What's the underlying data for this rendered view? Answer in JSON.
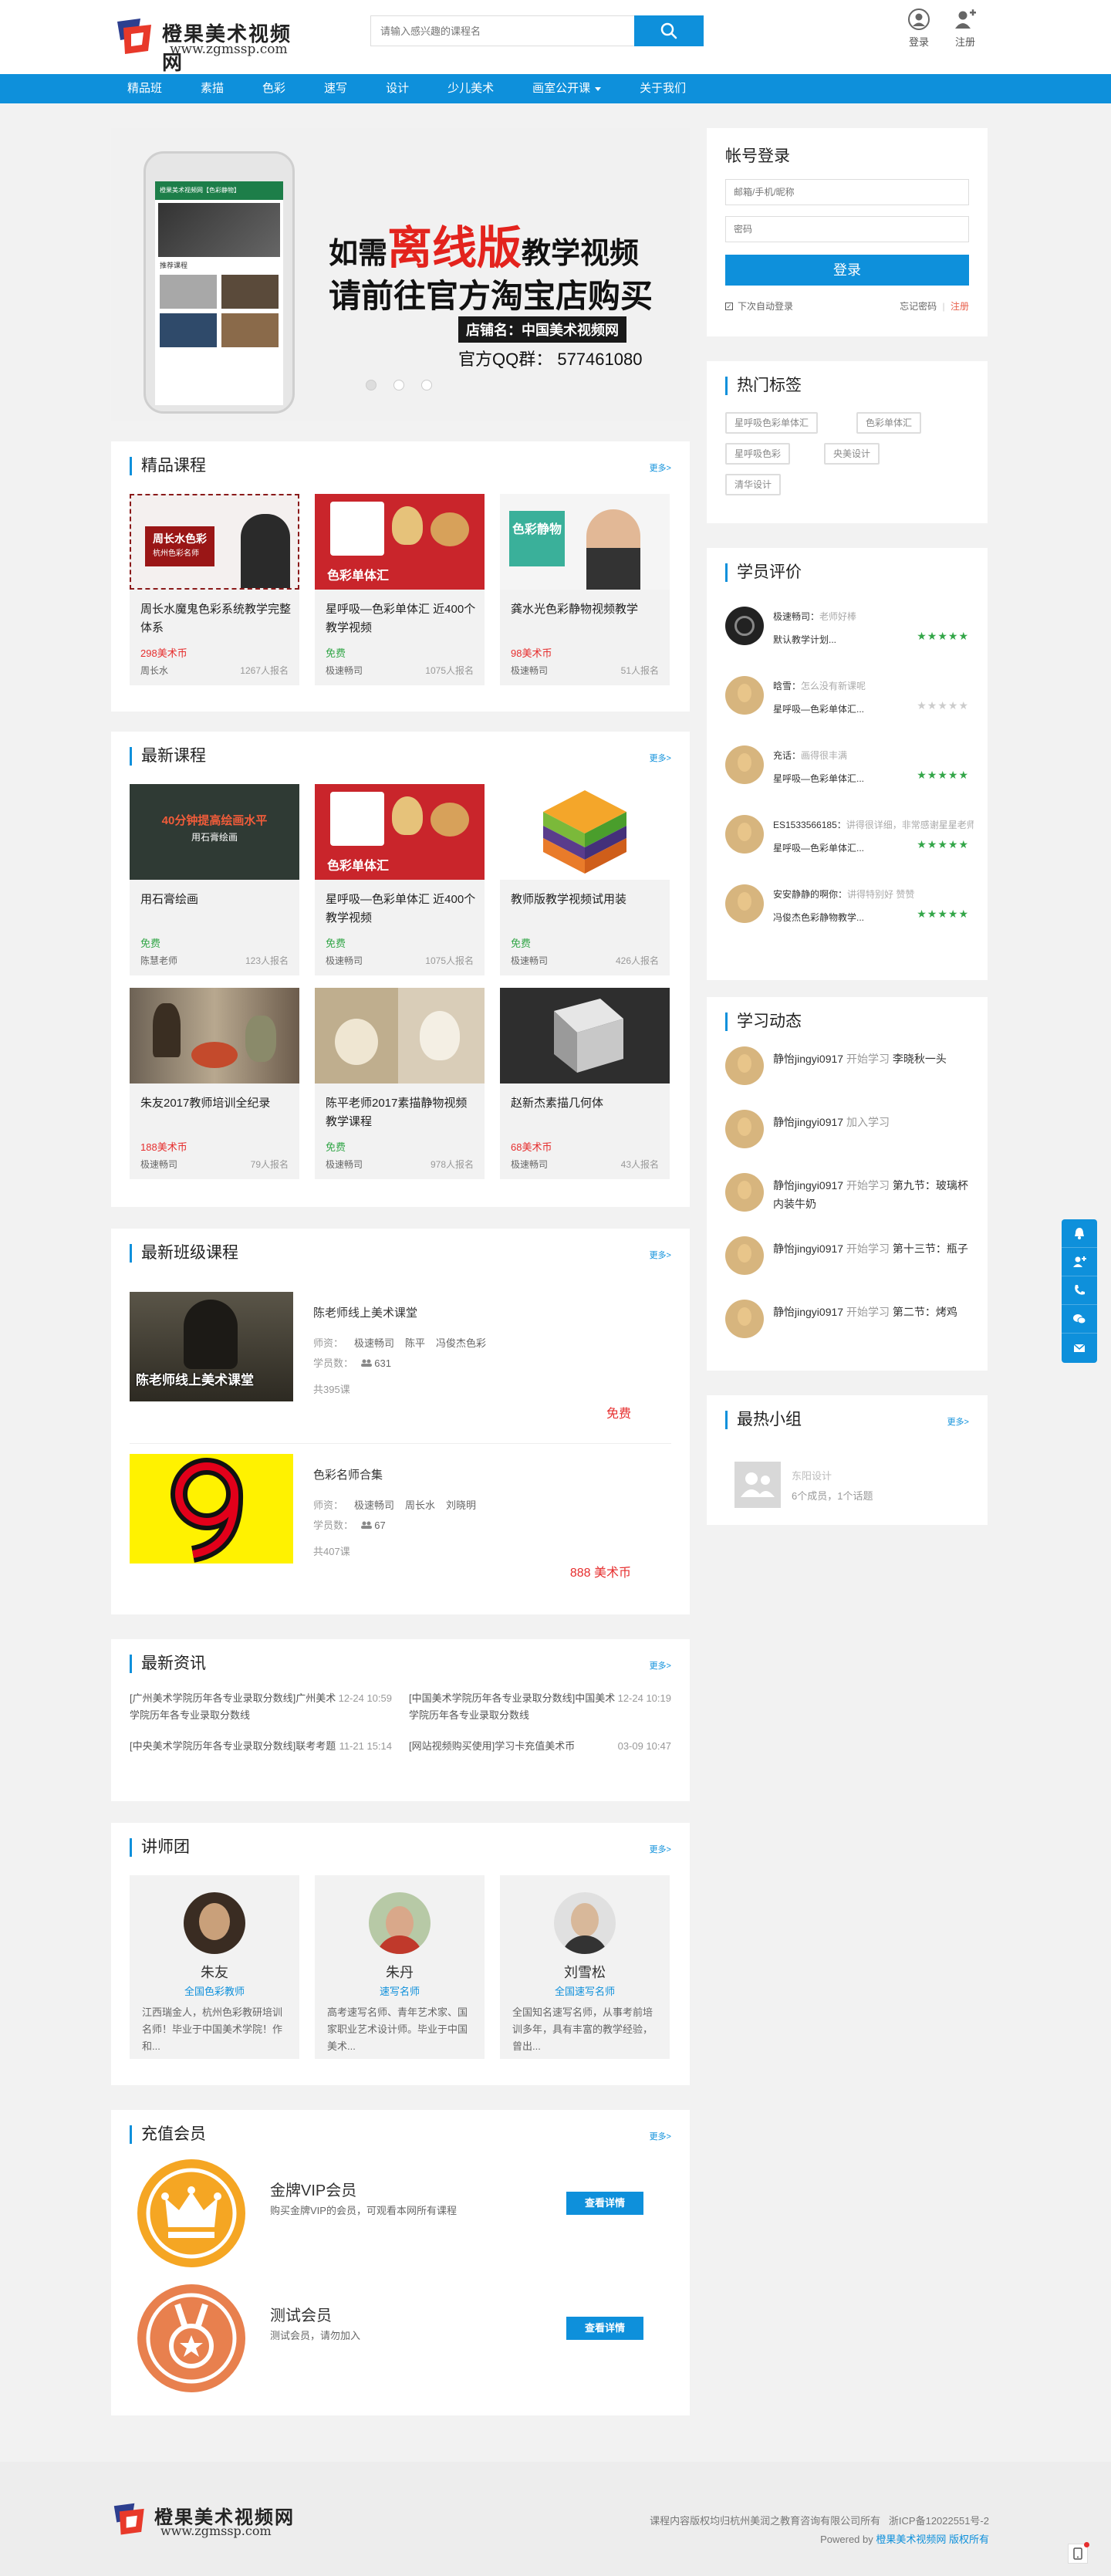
{
  "header": {
    "logo_title": "橙果美术视频网",
    "logo_url": "www.zgmssp.com",
    "search_placeholder": "请输入感兴趣的课程名",
    "login_label": "登录",
    "register_label": "注册"
  },
  "nav": [
    "精品班",
    "素描",
    "色彩",
    "速写",
    "设计",
    "少儿美术",
    "画室公开课",
    "关于我们"
  ],
  "banner": {
    "line1_pre": "如需",
    "line1_em": "离线版",
    "line1_post": "教学视频",
    "line2": "请前往官方淘宝店购买",
    "shop": "店铺名：中国美术视频网",
    "qq": "官方QQ群： 577461080",
    "phone_title": "橙果美术视频网【色彩静物】",
    "phone_sub": "推荐课程"
  },
  "featured": {
    "title": "精品课程",
    "more": "更多>",
    "items": [
      {
        "title": "周长水魔鬼色彩系统教学完整体系",
        "price": "298美术币",
        "author": "周长水",
        "students": "1267人报名",
        "img_text": "周长水色彩",
        "img_sub": "杭州色彩名师"
      },
      {
        "title": "星呼吸—色彩单体汇 近400个教学视频",
        "price": "免费",
        "author": "极速畅司",
        "students": "1075人报名",
        "img_text": "色彩单体汇"
      },
      {
        "title": "龚水光色彩静物视频教学",
        "price": "98美术币",
        "author": "极速畅司",
        "students": "51人报名",
        "img_text": "色彩静物"
      }
    ]
  },
  "latest": {
    "title": "最新课程",
    "more": "更多>",
    "items": [
      {
        "title": "用石膏绘画",
        "price": "免费",
        "author": "陈慧老师",
        "students": "123人报名",
        "img_text": "40分钟提高绘画水平",
        "img_sub": "用石膏绘画"
      },
      {
        "title": "星呼吸—色彩单体汇 近400个教学视频",
        "price": "免费",
        "author": "极速畅司",
        "students": "1075人报名",
        "img_text": "色彩单体汇"
      },
      {
        "title": "教师版教学视频试用装",
        "price": "免费",
        "author": "极速畅司",
        "students": "426人报名"
      },
      {
        "title": "朱友2017教师培训全纪录",
        "price": "188美术币",
        "author": "极速畅司",
        "students": "79人报名"
      },
      {
        "title": "陈平老师2017素描静物视频教学课程",
        "price": "免费",
        "author": "极速畅司",
        "students": "978人报名"
      },
      {
        "title": "赵新杰素描几何体",
        "price": "68美术币",
        "author": "极速畅司",
        "students": "43人报名"
      }
    ]
  },
  "classes": {
    "title": "最新班级课程",
    "more": "更多>",
    "items": [
      {
        "title": "陈老师线上美术课堂",
        "teachers_label": "师资：",
        "teachers": [
          "极速畅司",
          "陈平",
          "冯俊杰色彩"
        ],
        "students_label": "学员数：",
        "students": "631",
        "lessons": "共395课",
        "price": "免费",
        "img_text": "陈老师线上美术课堂"
      },
      {
        "title": "色彩名师合集",
        "teachers_label": "师资：",
        "teachers": [
          "极速畅司",
          "周长水",
          "刘晓明"
        ],
        "students_label": "学员数：",
        "students": "67",
        "lessons": "共407课",
        "price": "888 美术币"
      }
    ]
  },
  "news": {
    "title": "最新资讯",
    "more": "更多>",
    "items": [
      {
        "text": "[广州美术学院历年各专业录取分数线]广州美术学院历年各专业录取分数线",
        "date": "12-24 10:59"
      },
      {
        "text": "[中国美术学院历年各专业录取分数线]中国美术学院历年各专业录取分数线",
        "date": "12-24 10:19"
      },
      {
        "text": "[中央美术学院历年各专业录取分数线]联考考题",
        "date": "11-21 15:14"
      },
      {
        "text": "[网站视频购买使用]学习卡充值美术币",
        "date": "03-09 10:47"
      }
    ]
  },
  "teachers": {
    "title": "讲师团",
    "more": "更多>",
    "items": [
      {
        "name": "朱友",
        "title": "全国色彩教师",
        "desc": "江西瑞金人，杭州色彩教研培训名师！毕业于中国美术学院！作和..."
      },
      {
        "name": "朱丹",
        "title": "速写名师",
        "desc": "高考速写名师、青年艺术家、国家职业艺术设计师。毕业于中国美术..."
      },
      {
        "name": "刘雪松",
        "title": "全国速写名师",
        "desc": "全国知名速写名师，从事考前培训多年，具有丰富的教学经验，曾出..."
      }
    ]
  },
  "vip": {
    "title": "充值会员",
    "more": "更多>",
    "items": [
      {
        "name": "金牌VIP会员",
        "desc": "购买金牌VIP的会员，可观看本网所有课程",
        "button": "查看详情",
        "color": "#f5a623"
      },
      {
        "name": "测试会员",
        "desc": "测试会员，请勿加入",
        "button": "查看详情",
        "color": "#e8804e"
      }
    ]
  },
  "login": {
    "title": "帐号登录",
    "user_placeholder": "邮箱/手机/昵称",
    "pass_placeholder": "密码",
    "button": "登录",
    "remember": "下次自动登录",
    "forgot": "忘记密码",
    "sep": "|",
    "register": "注册"
  },
  "hot_tags": {
    "title": "热门标签",
    "items": [
      "星呼吸色彩单体汇",
      "色彩单体汇",
      "星呼吸色彩",
      "央美设计",
      "清华设计"
    ]
  },
  "reviews": {
    "title": "学员评价",
    "items": [
      {
        "user": "极速畅司",
        "comment": "老师好棒",
        "course": "默认教学计划...",
        "stars": "★★★★★",
        "rated": true
      },
      {
        "user": "晗雪",
        "comment": "怎么没有新课呢",
        "course": "星呼吸—色彩单体汇...",
        "stars": "★★★★★",
        "rated": false
      },
      {
        "user": "充话",
        "comment": "画得很丰满",
        "course": "星呼吸—色彩单体汇...",
        "stars": "★★★★★",
        "rated": true
      },
      {
        "user": "ES1533566185",
        "comment": "讲得很详细，非常感谢星星老师！",
        "course": "星呼吸—色彩单体汇...",
        "stars": "★★★★★",
        "rated": true
      },
      {
        "user": "安安静静的啊你",
        "comment": "讲得特别好 赞赞",
        "course": "冯俊杰色彩静物教学...",
        "stars": "★★★★★",
        "rated": true
      }
    ]
  },
  "dynamics": {
    "title": "学习动态",
    "items": [
      {
        "user": "静怡jingyi0917",
        "action": "开始学习",
        "target": "李晓秋一头"
      },
      {
        "user": "静怡jingyi0917",
        "action": "加入学习",
        "target": ""
      },
      {
        "user": "静怡jingyi0917",
        "action": "开始学习",
        "target": "第九节：玻璃杯内装牛奶"
      },
      {
        "user": "静怡jingyi0917",
        "action": "开始学习",
        "target": "第十三节：瓶子"
      },
      {
        "user": "静怡jingyi0917",
        "action": "开始学习",
        "target": "第二节：烤鸡"
      }
    ]
  },
  "groups": {
    "title": "最热小组",
    "more": "更多>",
    "items": [
      {
        "name": "东阳设计",
        "meta": "6个成员，1个话题"
      }
    ]
  },
  "footer": {
    "copyright": "课程内容版权均归杭州美润之教育咨询有限公司所有",
    "icp": "浙ICP备12022551号-2",
    "powered_pre": "Powered by",
    "powered_link": "橙果美术视频网 版权所有"
  },
  "colors": {
    "primary": "#0e90db",
    "price": "#e62e2e",
    "free": "#33a648",
    "page_bg": "#f2f2f2"
  }
}
